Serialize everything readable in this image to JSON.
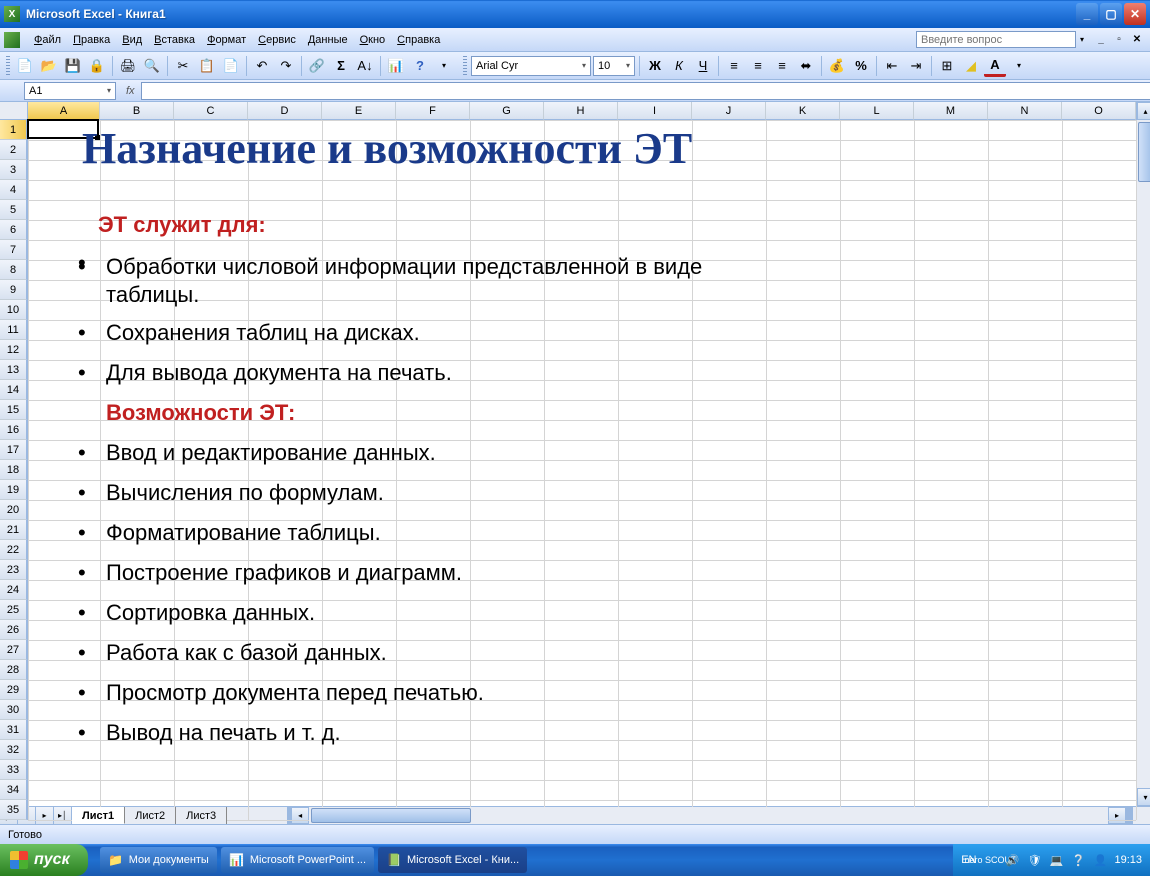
{
  "window": {
    "title": "Microsoft Excel - Книга1"
  },
  "menubar": {
    "items": [
      "Файл",
      "Правка",
      "Вид",
      "Вставка",
      "Формат",
      "Сервис",
      "Данные",
      "Окно",
      "Справка"
    ],
    "question_placeholder": "Введите вопрос"
  },
  "toolbar": {
    "font_name": "Arial Cyr",
    "font_size": "10"
  },
  "formula": {
    "namebox": "A1",
    "fx": "fx"
  },
  "grid": {
    "columns": [
      "A",
      "B",
      "C",
      "D",
      "E",
      "F",
      "G",
      "H",
      "I",
      "J",
      "K",
      "L",
      "M",
      "N",
      "O"
    ],
    "rows": [
      "1",
      "2",
      "3",
      "4",
      "5",
      "6",
      "7",
      "8",
      "9",
      "10",
      "11",
      "12",
      "13",
      "14",
      "15",
      "16",
      "17",
      "18",
      "19",
      "20",
      "21",
      "22",
      "23",
      "24",
      "25",
      "26",
      "27",
      "28",
      "29",
      "30",
      "31",
      "32",
      "33",
      "34",
      "35"
    ],
    "selected_cell": "A1"
  },
  "content": {
    "title": "Назначение и возможности ЭТ",
    "section1": "ЭТ служит для:",
    "sec1_items": [
      "Обработки числовой информации представленной в виде таблицы.",
      "Сохранения таблиц на дисках.",
      "Для вывода документа на печать."
    ],
    "section2": "Возможности ЭТ:",
    "sec2_items": [
      "Ввод и редактирование данных.",
      "Вычисления по формулам.",
      "Форматирование таблицы.",
      "Построение графиков и диаграмм.",
      "Сортировка данных.",
      "Работа как с базой данных.",
      "Просмотр документа перед печатью.",
      "Вывод на печать и т. д."
    ]
  },
  "sheets": {
    "tabs": [
      "Лист1",
      "Лист2",
      "Лист3"
    ],
    "active": 0
  },
  "status": {
    "text": "Готово"
  },
  "taskbar": {
    "start": "пуск",
    "items": [
      {
        "label": "Мои документы",
        "icon": "📁"
      },
      {
        "label": "Microsoft PowerPoint ...",
        "icon": "📊"
      },
      {
        "label": "Microsoft Excel - Кни...",
        "icon": "📗"
      }
    ],
    "active_item": 2,
    "lang": "EN",
    "nero": "nero SCOUT",
    "time": "19:13"
  }
}
